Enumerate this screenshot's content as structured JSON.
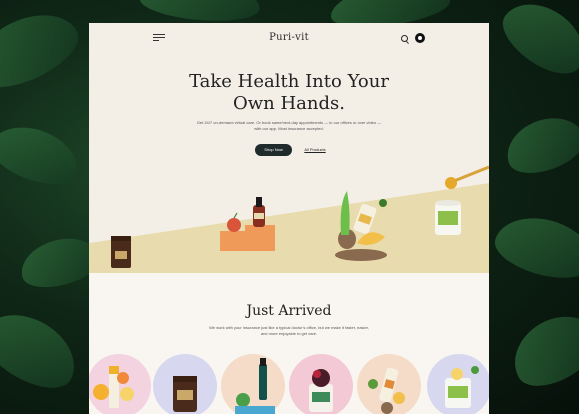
{
  "nav": {
    "logo": "Puri-vit",
    "menu_icon": "menu-icon",
    "search_icon": "search-icon",
    "account_icon": "account-icon"
  },
  "hero": {
    "title_line1": "Take Health Into Your",
    "title_line2": "Own Hands.",
    "subtitle": "Get 24/7 on-demand virtual care. Or book same/next-day appointments — in our offices or over video — with our app. Most insurance accepted.",
    "primary_button": "Shop Now",
    "secondary_link": "All Products"
  },
  "just_arrived": {
    "title": "Just Arrived",
    "subtitle": "We work with your insurance just like a typical doctor's office, but we make it faster, easier, and more enjoyable to get care."
  },
  "colors": {
    "backdrop": "#0f2616",
    "page_bg": "#f3efe6",
    "hero_yellow": "#e8dcae",
    "button_dark": "#1f2a2a",
    "circle_pink": "#f3d3df",
    "circle_lavender": "#d7d8f0",
    "circle_peach": "#f4dcc8",
    "circle_rose": "#f2c9d4"
  }
}
